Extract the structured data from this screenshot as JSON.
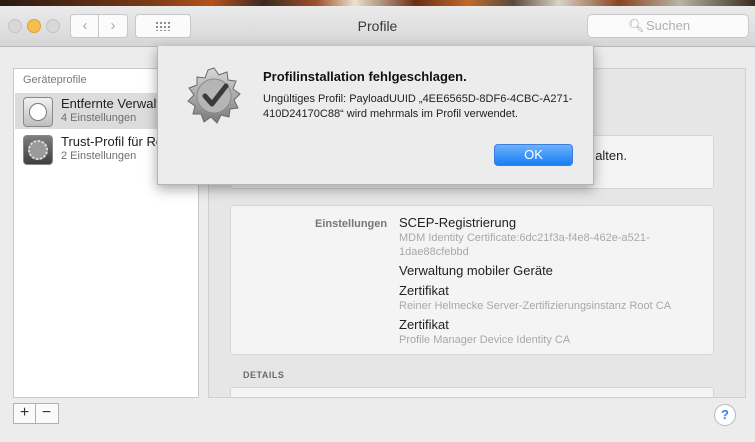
{
  "window": {
    "title": "Profile",
    "search_placeholder": "Suchen"
  },
  "sidebar": {
    "header": "Geräteprofile",
    "items": [
      {
        "label": "Entfernte Verwalt",
        "sub": "4 Einstellungen",
        "icon": "enrollment-profile-icon",
        "selected": true
      },
      {
        "label": "Trust-Profil für Re",
        "sub": "2 Einstellungen",
        "icon": "gear-profile-icon",
        "selected": false
      }
    ]
  },
  "main": {
    "info_text_fragment": "alten.",
    "settings_label": "Einstellungen",
    "settings": [
      {
        "title": "SCEP-Registrierung",
        "detail": "MDM Identity Certificate:6dc21f3a-f4e8-462e-a521-1dae88cfebbd"
      },
      {
        "title": "Verwaltung mobiler Geräte",
        "detail": ""
      },
      {
        "title": "Zertifikat",
        "detail": "Reiner Helmecke Server-Zertifizierungsinstanz Root CA"
      },
      {
        "title": "Zertifikat",
        "detail": "Profile Manager Device Identity CA"
      }
    ],
    "details_header": "DETAILS"
  },
  "alert": {
    "title": "Profilinstallation fehlgeschlagen.",
    "message": "Ungültiges Profil: PayloadUUID „4EE6565D-8DF6-4CBC-A271-410D24170C88“ wird mehrmals im Profil verwendet.",
    "ok_label": "OK"
  },
  "footer": {
    "plus": "+",
    "minus": "−",
    "help": "?"
  },
  "colors": {
    "accent": "#1a7ef5",
    "minimize": "#f5bf4f"
  }
}
